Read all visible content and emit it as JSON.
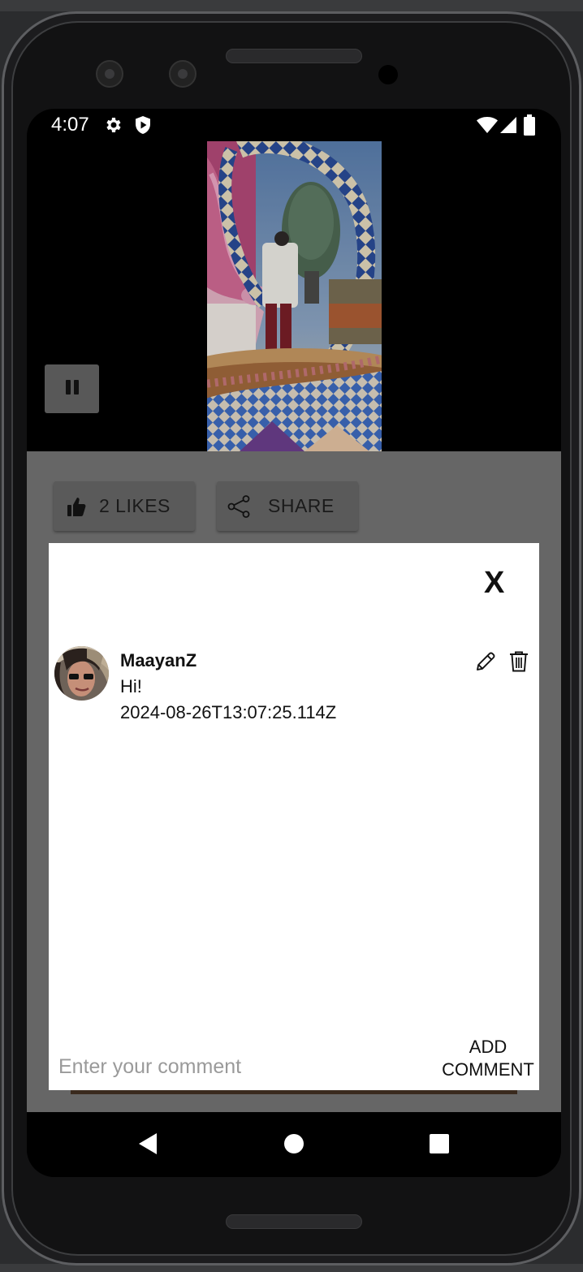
{
  "status_bar": {
    "time": "4:07",
    "left_icons": [
      "gear-icon",
      "shield-play-icon"
    ],
    "right_icons": [
      "wifi-icon",
      "signal-icon",
      "battery-icon"
    ]
  },
  "video": {
    "pause_icon": "pause-icon"
  },
  "actions": {
    "likes_label": "2 LIKES",
    "share_label": "SHARE",
    "like_icon": "thumbs-up-icon",
    "share_icon": "share-icon"
  },
  "comments_modal": {
    "close_label": "X",
    "comments": [
      {
        "username": "MaayanZ",
        "text": "Hi!",
        "date": "2024-08-26T13:07:25.114Z"
      }
    ],
    "input_placeholder": "Enter your comment",
    "input_value": "",
    "add_button_line1": "ADD",
    "add_button_line2": "COMMENT"
  },
  "navigation": {
    "back_icon": "back-triangle-icon",
    "home_icon": "home-circle-icon",
    "recents_icon": "recents-square-icon"
  }
}
